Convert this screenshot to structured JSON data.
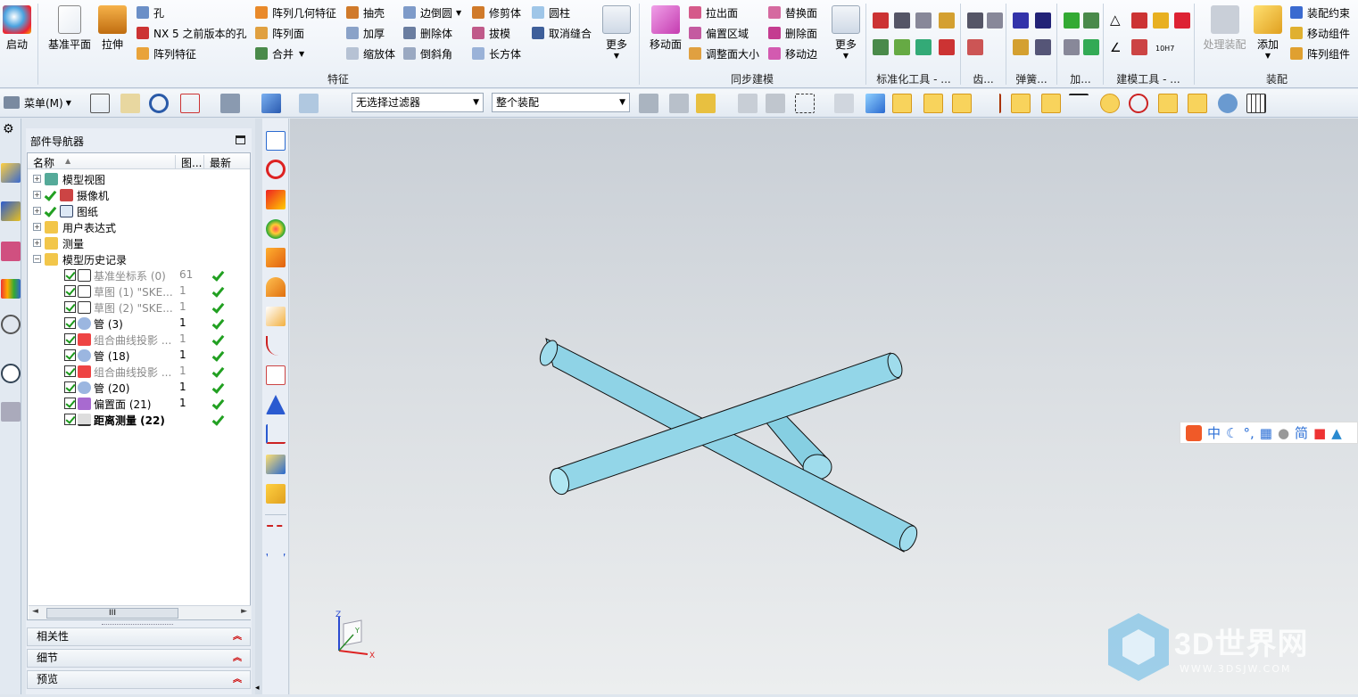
{
  "ribbon": {
    "start": "启动",
    "datum_plane": "基准平面",
    "extrude": "拉伸",
    "hole": "孔",
    "nx5_hole": "NX 5 之前版本的孔",
    "pattern_feature": "阵列特征",
    "pattern_geometry": "阵列几何特征",
    "pattern_face": "阵列面",
    "unite": "合并",
    "shell": "抽壳",
    "thicken": "加厚",
    "scale_body": "缩放体",
    "edge_blend": "边倒圆",
    "delete_body": "删除体",
    "chamfer": "倒斜角",
    "trim_body": "修剪体",
    "draft": "拔模",
    "block": "长方体",
    "cylinder": "圆柱",
    "unsew": "取消缝合",
    "more1": "更多",
    "feature_group": "特征",
    "move_face": "移动面",
    "pull_face": "拉出面",
    "offset_region": "偏置区域",
    "resize_face": "调整面大小",
    "replace_face": "替换面",
    "delete_face": "删除面",
    "move_edge": "移动边",
    "more2": "更多",
    "sync_group": "同步建模",
    "std_tools": "标准化工具 - ...",
    "gear": "齿...",
    "spring": "弹簧...",
    "add": "加...",
    "model_tools": "建模工具 - ...",
    "process_assembly": "处理装配",
    "add_comp": "添加",
    "assembly_constraints": "装配约束",
    "move_component": "移动组件",
    "pattern_component": "阵列组件",
    "assembly_group": "装配",
    "hole_std_label": "10H7"
  },
  "toolbar": {
    "menu": "菜单(M)",
    "filter": "无选择过滤器",
    "scope": "整个装配"
  },
  "navigator": {
    "title": "部件导航器",
    "col_name": "名称",
    "col_pic": "图...",
    "col_latest": "最新",
    "rows": [
      {
        "name": "模型视图"
      },
      {
        "name": "摄像机"
      },
      {
        "name": "图纸"
      },
      {
        "name": "用户表达式"
      },
      {
        "name": "测量"
      },
      {
        "name": "模型历史记录"
      },
      {
        "name": "基准坐标系 (0)",
        "count": "61"
      },
      {
        "name": "草图 (1) \"SKE...",
        "count": "1"
      },
      {
        "name": "草图 (2) \"SKE...",
        "count": "1"
      },
      {
        "name": "管 (3)",
        "count": "1"
      },
      {
        "name": "组合曲线投影 ...",
        "count": "1"
      },
      {
        "name": "管 (18)",
        "count": "1"
      },
      {
        "name": "组合曲线投影 ...",
        "count": "1"
      },
      {
        "name": "管 (20)",
        "count": "1"
      },
      {
        "name": "偏置面 (21)",
        "count": "1"
      },
      {
        "name": "距离测量 (22)"
      }
    ],
    "scroll_thumb": "III",
    "sections": [
      "相关性",
      "细节",
      "预览"
    ]
  },
  "ime": {
    "zh": "中",
    "simp": "简"
  },
  "watermark": {
    "brand": "3D世界网",
    "url": "WWW.3DSJW.COM"
  },
  "axes": {
    "x": "X",
    "y": "Y",
    "z": "Z"
  }
}
